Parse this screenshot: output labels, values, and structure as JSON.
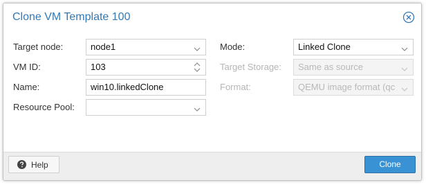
{
  "dialog": {
    "title": "Clone VM Template 100"
  },
  "left": {
    "target_node": {
      "label": "Target node:",
      "value": "node1"
    },
    "vm_id": {
      "label": "VM ID:",
      "value": "103"
    },
    "name": {
      "label": "Name:",
      "value": "win10.linkedClone"
    },
    "resource_pool": {
      "label": "Resource Pool:",
      "value": ""
    }
  },
  "right": {
    "mode": {
      "label": "Mode:",
      "value": "Linked Clone"
    },
    "target_storage": {
      "label": "Target Storage:",
      "value": "Same as source"
    },
    "format": {
      "label": "Format:",
      "value": "QEMU image format (qc"
    }
  },
  "footer": {
    "help_label": "Help",
    "clone_label": "Clone"
  },
  "colors": {
    "title": "#3379b5",
    "primary_button": "#3892d4"
  },
  "icons": {
    "close": "close-circle-icon",
    "help": "question-circle-icon",
    "dropdown": "chevron-down-icon",
    "spinner": "spinner-icon"
  }
}
